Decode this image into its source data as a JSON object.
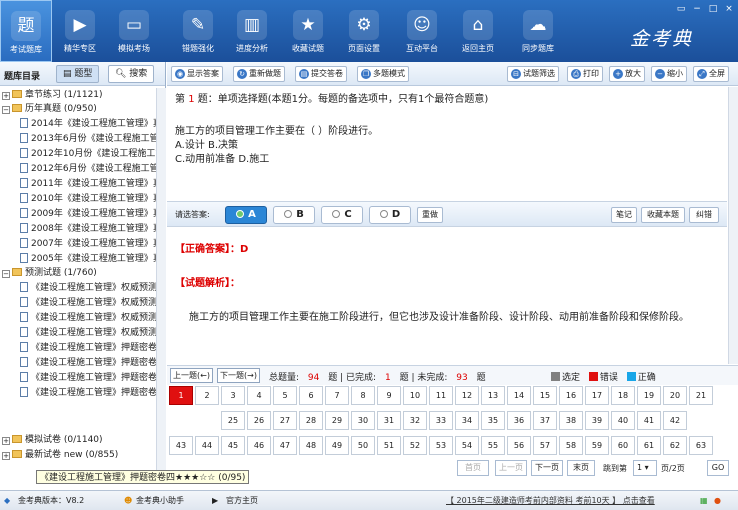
{
  "nav": [
    {
      "label": "考试题库",
      "icon": "题"
    },
    {
      "label": "精华专区",
      "icon": "▶"
    },
    {
      "label": "模拟考场",
      "icon": "▭"
    },
    {
      "label": "错题强化",
      "icon": "✎"
    },
    {
      "label": "进度分析",
      "icon": "▥"
    },
    {
      "label": "收藏试题",
      "icon": "★"
    },
    {
      "label": "页面设置",
      "icon": "⚙"
    },
    {
      "label": "互动平台",
      "icon": "☺"
    },
    {
      "label": "返回主页",
      "icon": "⌂"
    },
    {
      "label": "同步题库",
      "icon": "☁"
    }
  ],
  "logo": "金考典",
  "sidebar": {
    "title": "题库目录",
    "btn_tree": "题型",
    "btn_search": "搜索",
    "items": [
      {
        "label": "章节练习 (1/1121)",
        "type": "folder",
        "level": 0,
        "sign": "+"
      },
      {
        "label": "历年真题 (0/950)",
        "type": "folder",
        "level": 0,
        "sign": "−"
      },
      {
        "label": "2014年《建设工程施工管理》真",
        "type": "doc",
        "level": 1
      },
      {
        "label": "2013年6月份《建设工程施工管",
        "type": "doc",
        "level": 1
      },
      {
        "label": "2012年10月份《建设工程施工管",
        "type": "doc",
        "level": 1
      },
      {
        "label": "2012年6月份《建设工程施工管",
        "type": "doc",
        "level": 1
      },
      {
        "label": "2011年《建设工程施工管理》真",
        "type": "doc",
        "level": 1
      },
      {
        "label": "2010年《建设工程施工管理》真",
        "type": "doc",
        "level": 1
      },
      {
        "label": "2009年《建设工程施工管理》真",
        "type": "doc",
        "level": 1
      },
      {
        "label": "2008年《建设工程施工管理》真",
        "type": "doc",
        "level": 1
      },
      {
        "label": "2007年《建设工程施工管理》真",
        "type": "doc",
        "level": 1
      },
      {
        "label": "2005年《建设工程施工管理》真",
        "type": "doc",
        "level": 1
      },
      {
        "label": "预测试题 (1/760)",
        "type": "folder",
        "level": 0,
        "sign": "−"
      },
      {
        "label": "《建设工程施工管理》权威预测",
        "type": "doc",
        "level": 1
      },
      {
        "label": "《建设工程施工管理》权威预测",
        "type": "doc",
        "level": 1
      },
      {
        "label": "《建设工程施工管理》权威预测",
        "type": "doc",
        "level": 1
      },
      {
        "label": "《建设工程施工管理》权威预测",
        "type": "doc",
        "level": 1
      },
      {
        "label": "《建设工程施工管理》押题密卷",
        "type": "doc",
        "level": 1
      },
      {
        "label": "《建设工程施工管理》押题密卷",
        "type": "doc",
        "level": 1
      },
      {
        "label": "《建设工程施工管理》押题密卷",
        "type": "doc",
        "level": 1
      },
      {
        "label": "《建设工程施工管理》押题密卷",
        "type": "doc",
        "level": 1
      },
      {
        "label": "模拟试卷 (0/1140)",
        "type": "folder",
        "level": 0,
        "sign": "+"
      },
      {
        "label": "最新试卷 new (0/855)",
        "type": "folder",
        "level": 0,
        "sign": "+"
      }
    ],
    "tooltip": "《建设工程施工管理》押题密卷四★★★☆☆ (0/95)"
  },
  "toolbar": {
    "show_answer": "显示答案",
    "redo_wrong": "重新做题",
    "submit": "提交答卷",
    "multi_mode": "多题模式",
    "filter": "试题筛选",
    "print": "打印",
    "zoom_in": "放大",
    "zoom_out": "缩小",
    "fullscreen": "全屏"
  },
  "question": {
    "prefix": "第",
    "number": "1",
    "header_rest": "题：单项选择题(本题1分。每题的备选项中，只有1个最符合题意)",
    "stem": "施工方的项目管理工作主要在（  ）阶段进行。",
    "options_line1": "A.设计 B.决策",
    "options_line2": "C.动用前准备 D.施工"
  },
  "answer_bar": {
    "label": "请选答案:",
    "choices": [
      "A",
      "B",
      "C",
      "D"
    ],
    "selected": "A",
    "redo": "重做",
    "notes": "笔记",
    "favorite": "收藏本题",
    "report": "纠错"
  },
  "explain": {
    "correct_label": "【正确答案】：D",
    "analysis_label": "【试题解析】：",
    "analysis_text": "施工方的项目管理工作主要在施工阶段进行，但它也涉及设计准备阶段、设计阶段、动用前准备阶段和保修阶段。"
  },
  "gridbar": {
    "prev": "上一题(←)",
    "next": "下一题(→)",
    "total_label": "总题量:",
    "total": "94",
    "unit1": "题",
    "done_label": "已完成:",
    "done": "1",
    "unit2": "题",
    "undone_label": "未完成:",
    "undone": "93",
    "unit3": "题",
    "legend_selected": "选定",
    "legend_wrong": "错误",
    "legend_right": "正确",
    "color_selected": "#808080",
    "color_wrong": "#e01010",
    "color_right": "#18a6e8"
  },
  "grid": {
    "current": 1,
    "row1": [
      "1",
      "2",
      "3",
      "4",
      "5",
      "6",
      "7",
      "8",
      "9",
      "10",
      "11",
      "12",
      "13",
      "14",
      "15",
      "16",
      "17",
      "18",
      "19",
      "20",
      "21"
    ],
    "row2": [
      "25",
      "26",
      "27",
      "28",
      "29",
      "30",
      "31",
      "32",
      "33",
      "34",
      "35",
      "36",
      "37",
      "38",
      "39",
      "40",
      "41",
      "42"
    ],
    "row3": [
      "43",
      "44",
      "45",
      "46",
      "47",
      "48",
      "49",
      "50",
      "51",
      "52",
      "53",
      "54",
      "55",
      "56",
      "57",
      "58",
      "59",
      "60",
      "61",
      "62",
      "63"
    ]
  },
  "pager": {
    "first": "首页",
    "prev": "上一页",
    "next": "下一页",
    "last": "末页",
    "jump_label": "跳到第",
    "page_value": "1",
    "page_total": "页/2页",
    "go": "GO"
  },
  "status": {
    "version": "金考典版本：V8.2",
    "helper": "金考典小助手",
    "homepage": "官方主页",
    "news": "【 2015年二级建造师考前内部资料 考前10天 】 点击查看"
  }
}
